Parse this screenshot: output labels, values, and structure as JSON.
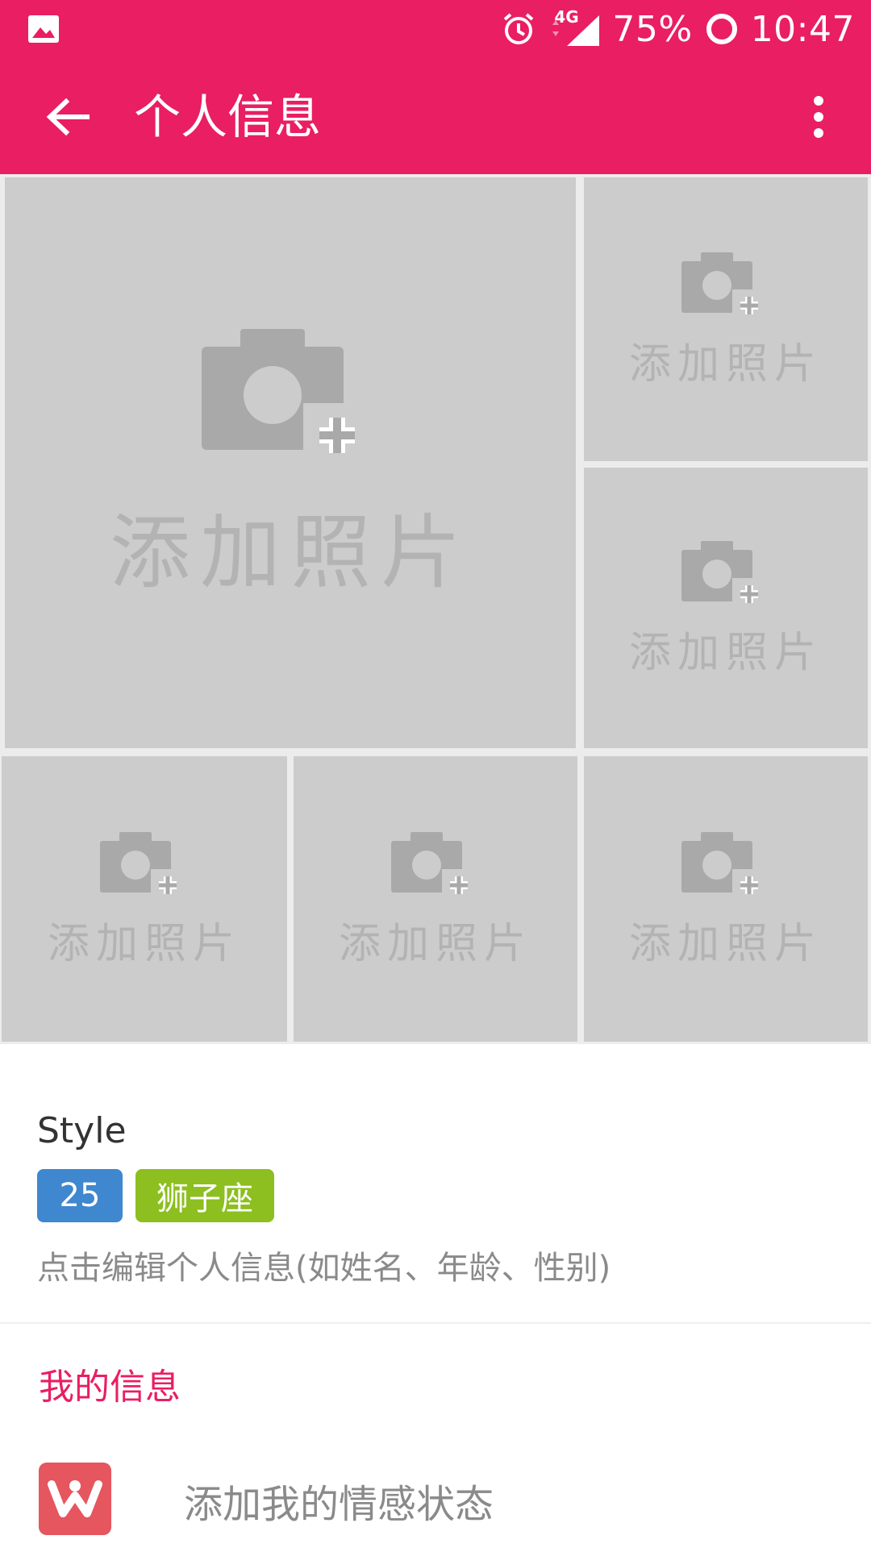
{
  "status_bar": {
    "network": "4G",
    "battery": "75%",
    "time": "10:47"
  },
  "toolbar": {
    "title": "个人信息"
  },
  "photos": {
    "add_label": "添加照片"
  },
  "profile": {
    "name": "Style",
    "age": "25",
    "zodiac": "狮子座",
    "edit_hint": "点击编辑个人信息(如姓名、年龄、性别)",
    "age_badge_color": "#3f87cf",
    "zodiac_badge_color": "#8cbf1f"
  },
  "my_info": {
    "section_title": "我的信息",
    "relationship_label": "添加我的情感状态"
  },
  "colors": {
    "primary": "#e91e63",
    "tile": "#cccccc",
    "placeholder": "#b3b3b3"
  }
}
